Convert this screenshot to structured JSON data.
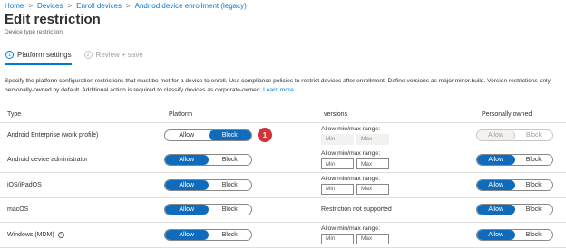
{
  "breadcrumb": {
    "items": [
      "Home",
      "Devices",
      "Enroll devices",
      "Andriod device enrollment (legacy)"
    ],
    "separator": ">"
  },
  "header": {
    "title": "Edit restriction",
    "subtitle": "Device type restriction"
  },
  "steps": [
    {
      "number": "1",
      "label": "Platform settings",
      "state": "active"
    },
    {
      "number": "2",
      "label": "Review + save",
      "state": "inactive"
    }
  ],
  "description": {
    "line1": "Specify the platform configuration restrictions that must be met for a device to enroll. Use compliance policies to restrict devices after enrollment. Define versions as major.minor.build. Version restrictions only",
    "line2": "personally-owned by default. Additional action is required to classify devices as corporate-owned.",
    "link": "Learn more"
  },
  "table": {
    "headers": {
      "type": "Type",
      "platform": "Platform",
      "versions": "versions",
      "owned": "Personally owned"
    },
    "toggle_labels": {
      "allow": "Allow",
      "block": "Block"
    },
    "range_label": "Allow min/max range:",
    "min_placeholder": "Min",
    "max_placeholder": "Max",
    "badge": "1",
    "rows": [
      {
        "type": "Android Enterprise (work profile)",
        "platform": "Block",
        "versions": "range-disabled",
        "owned": "Allow",
        "owned_disabled": true
      },
      {
        "type": "Android device administrator",
        "platform": "Allow",
        "versions": "range",
        "owned": "Allow",
        "owned_disabled": false
      },
      {
        "type": "iOS/iPadOS",
        "platform": "Allow",
        "versions": "range",
        "owned": "Allow",
        "owned_disabled": false
      },
      {
        "type": "macOS",
        "platform": "Allow",
        "versions": "Restriction not supported",
        "owned": "Allow",
        "owned_disabled": false
      },
      {
        "type": "Windows (MDM)",
        "platform": "Allow",
        "versions": "range",
        "owned": "Allow",
        "owned_disabled": false
      }
    ]
  },
  "colors": {
    "accent": "#0f6cbd",
    "link": "#0078d4",
    "badge": "#d13438"
  },
  "icons": {
    "info": "info-icon"
  }
}
